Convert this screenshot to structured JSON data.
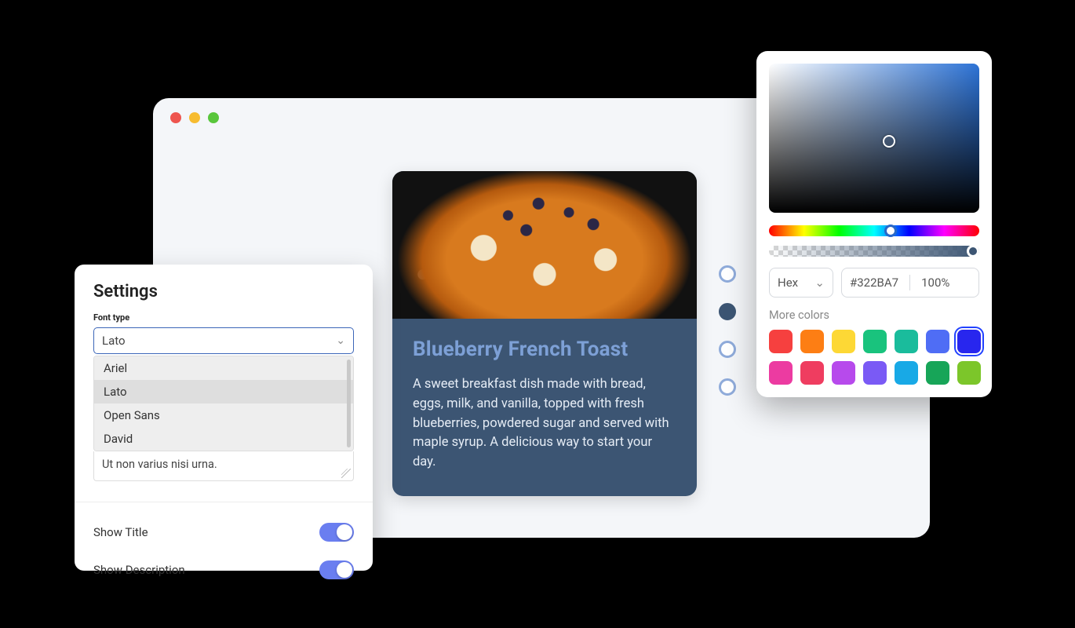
{
  "browser": {
    "dots": [
      "red",
      "yellow",
      "green"
    ]
  },
  "card": {
    "title": "Blueberry French Toast",
    "description": "A sweet breakfast dish made with bread, eggs, milk, and vanilla, topped with fresh blueberries, powdered sugar and served with maple syrup. A delicious way to start your day."
  },
  "radios": {
    "count": 4,
    "selected_index": 1
  },
  "settings": {
    "title": "Settings",
    "font_label": "Font type",
    "font_value": "Lato",
    "font_options": [
      "Ariel",
      "Lato",
      "Open Sans",
      "David"
    ],
    "font_hover_index": 1,
    "textarea_value": "Ut non varius nisi urna.",
    "toggles": [
      {
        "label": "Show Title",
        "on": true
      },
      {
        "label": "Show Description",
        "on": true
      }
    ]
  },
  "picker": {
    "model_label": "Hex",
    "hex_value": "#322BA7",
    "alpha_label": "100%",
    "more_colors_label": "More colors",
    "swatches_row1": [
      "#f6403f",
      "#fd7e14",
      "#fdd835",
      "#19c37d",
      "#1abc9c",
      "#4f6df5",
      "#2826ee"
    ],
    "swatches_row2": [
      "#ec3ba1",
      "#ef3d60",
      "#b74aec",
      "#7a5af5",
      "#18a9e6",
      "#17a558",
      "#7cc62a"
    ],
    "selected_swatch_index": 6
  }
}
